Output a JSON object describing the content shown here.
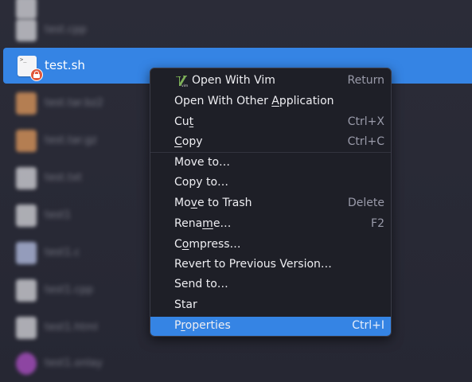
{
  "background_files": [
    {
      "name": "test.cpp",
      "icon": "text-file-icon"
    },
    {
      "name": "test.sh",
      "icon": "shell-script-icon",
      "selected": true,
      "badge": "lock-badge-icon"
    },
    {
      "name": "test.tar.bz2",
      "icon": "archive-icon"
    },
    {
      "name": "test.tar.gz",
      "icon": "archive-icon"
    },
    {
      "name": "test.txt",
      "icon": "text-file-icon"
    },
    {
      "name": "test1",
      "icon": "file-icon"
    },
    {
      "name": "test1.c",
      "icon": "c-file-icon"
    },
    {
      "name": "test1.cpp",
      "icon": "cpp-file-icon"
    },
    {
      "name": "test1.html",
      "icon": "html-file-icon"
    },
    {
      "name": "test1.onlay",
      "icon": "media-file-icon"
    }
  ],
  "selected_file": {
    "name": "test.sh",
    "icon_glyph": ">_"
  },
  "context_menu": {
    "items": [
      {
        "id": "open-with-vim",
        "label": "Open With Vim",
        "accel": "Return",
        "icon": "vim-icon"
      },
      {
        "id": "open-with-other",
        "label_pre": "Open With Other ",
        "label_u": "A",
        "label_post": "pplication",
        "accel": ""
      },
      {
        "id": "cut",
        "label_pre": "Cu",
        "label_u": "t",
        "label_post": "",
        "accel": "Ctrl+X"
      },
      {
        "id": "copy",
        "label_pre": "",
        "label_u": "C",
        "label_post": "opy",
        "accel": "Ctrl+C"
      },
      {
        "id": "move-to",
        "label": "Move to…",
        "accel": ""
      },
      {
        "id": "copy-to",
        "label": "Copy to…",
        "accel": ""
      },
      {
        "id": "move-to-trash",
        "label_pre": "Mo",
        "label_u": "v",
        "label_post": "e to Trash",
        "accel": "Delete"
      },
      {
        "id": "rename",
        "label_pre": "Rena",
        "label_u": "m",
        "label_post": "e…",
        "accel": "F2"
      },
      {
        "id": "compress",
        "label_pre": "C",
        "label_u": "o",
        "label_post": "mpress…",
        "accel": ""
      },
      {
        "id": "revert",
        "label": "Revert to Previous Version…",
        "accel": ""
      },
      {
        "id": "send-to",
        "label": "Send to…",
        "accel": ""
      },
      {
        "id": "star",
        "label": "Star",
        "accel": ""
      },
      {
        "id": "properties",
        "label_pre": "P",
        "label_u": "r",
        "label_post": "operties",
        "accel": "Ctrl+I",
        "active": true
      }
    ]
  },
  "colors": {
    "accent": "#3584e4",
    "menu_bg": "#1e1f27",
    "window_bg": "#2a2b36"
  }
}
